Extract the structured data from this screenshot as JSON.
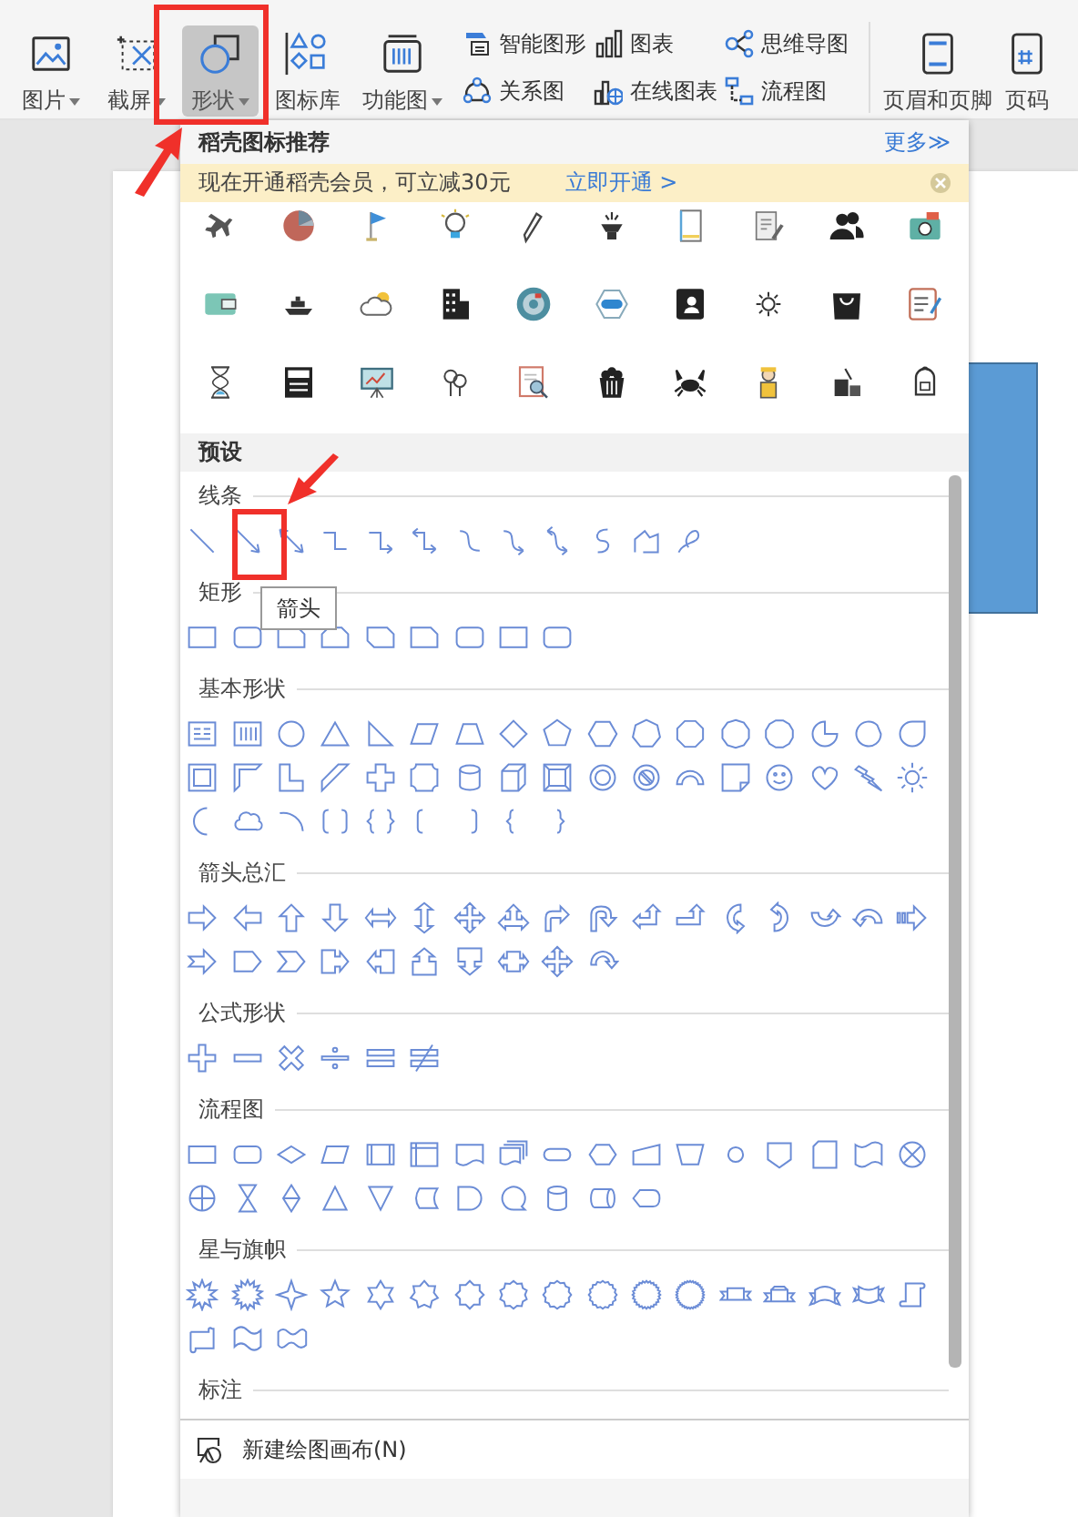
{
  "toolbar": {
    "large_buttons": [
      {
        "label": "图片",
        "dropdown": true,
        "selected": false
      },
      {
        "label": "截屏",
        "dropdown": true,
        "selected": false
      },
      {
        "label": "形状",
        "dropdown": true,
        "selected": true
      },
      {
        "label": "图标库",
        "dropdown": false,
        "selected": false
      },
      {
        "label": "功能图",
        "dropdown": true,
        "selected": false
      }
    ],
    "small_buttons": [
      {
        "label": "智能图形"
      },
      {
        "label": "关系图"
      },
      {
        "label": "图表"
      },
      {
        "label": "在线图表"
      },
      {
        "label": "思维导图"
      },
      {
        "label": "流程图"
      }
    ],
    "right_buttons": [
      {
        "label": "页眉和页脚"
      },
      {
        "label": "页码"
      }
    ]
  },
  "shapes_panel": {
    "recommend_title": "稻壳图标推荐",
    "more_link": "更多≫",
    "banner": {
      "text": "现在开通稻壳会员，可立减30元",
      "link": "立即开通 >"
    },
    "preset_title": "预设",
    "sections": [
      {
        "title": "线条"
      },
      {
        "title": "矩形"
      },
      {
        "title": "基本形状"
      },
      {
        "title": "箭头总汇"
      },
      {
        "title": "公式形状"
      },
      {
        "title": "流程图"
      },
      {
        "title": "星与旗帜"
      },
      {
        "title": "标注"
      }
    ],
    "tooltip": "箭头",
    "footer_button": "新建绘图画布(N)"
  }
}
